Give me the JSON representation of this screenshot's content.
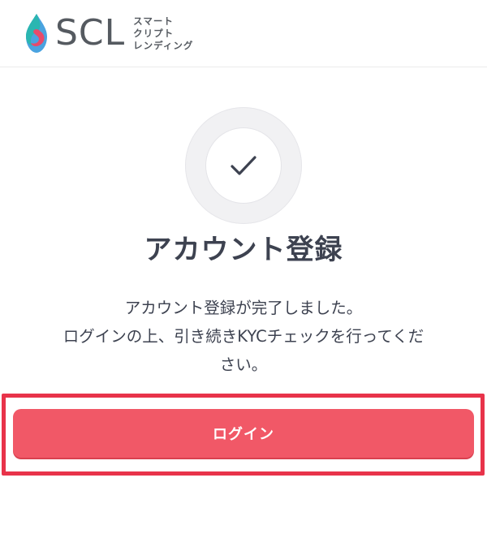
{
  "header": {
    "logo_text": "SCL",
    "logo_sub_lines": [
      "スマート",
      "クリプト",
      "レンディング"
    ]
  },
  "success": {
    "icon": "checkmark-icon",
    "title": "アカウント登録",
    "message_lines": [
      "アカウント登録が完了しました。",
      "ログインの上、引き続きKYCチェックを行ってくだ",
      "さい。"
    ]
  },
  "actions": {
    "login_label": "ログイン"
  },
  "colors": {
    "accent": "#f15867",
    "highlight": "#e8334a",
    "text": "#3d4250",
    "logo_teal": "#2bb6b1",
    "logo_pink": "#e84a6a",
    "logo_blue": "#4aa3e0"
  }
}
